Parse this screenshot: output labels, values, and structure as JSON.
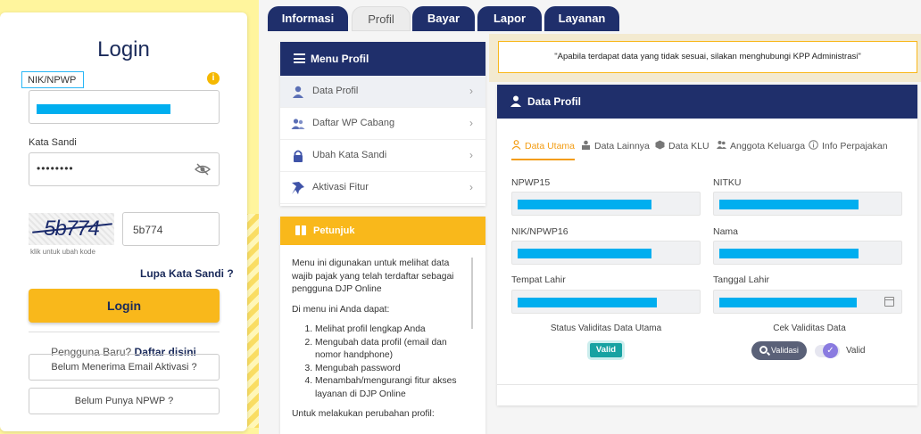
{
  "login": {
    "title": "Login",
    "nik_label": "NIK/NPWP",
    "password_label": "Kata Sandi",
    "password_value": "••••••••",
    "captcha_text": "5b774",
    "captcha_input_value": "5b774",
    "captcha_hint": "klik untuk ubah kode",
    "forgot_label": "Lupa Kata Sandi ?",
    "login_button": "Login",
    "new_user_prefix": "Pengguna Baru?",
    "new_user_link": "Daftar disini",
    "email_activation_button": "Belum Menerima Email Aktivasi ?",
    "no_npwp_button": "Belum Punya NPWP ?"
  },
  "tabs": [
    {
      "label": "Informasi",
      "active": false
    },
    {
      "label": "Profil",
      "active": true
    },
    {
      "label": "Bayar",
      "active": false
    },
    {
      "label": "Lapor",
      "active": false
    },
    {
      "label": "Layanan",
      "active": false
    }
  ],
  "menu": {
    "title": "Menu Profil",
    "items": [
      {
        "label": "Data Profil",
        "icon": "user-icon"
      },
      {
        "label": "Daftar WP Cabang",
        "icon": "users-icon"
      },
      {
        "label": "Ubah Kata Sandi",
        "icon": "lock-icon"
      },
      {
        "label": "Aktivasi Fitur",
        "icon": "pin-icon"
      }
    ]
  },
  "petunjuk": {
    "title": "Petunjuk",
    "intro": "Menu ini digunakan untuk melihat data wajib pajak yang telah terdaftar sebagai pengguna DJP Online",
    "subtitle": "Di menu ini Anda dapat:",
    "list": [
      "Melihat profil lengkap Anda",
      "Mengubah data profil (email dan nomor handphone)",
      "Mengubah password",
      "Menambah/mengurangi fitur akses layanan di DJP Online"
    ],
    "footer": "Untuk melakukan perubahan profil:"
  },
  "notice": "\"Apabila terdapat data yang tidak sesuai, silakan menghubungi KPP Administrasi\"",
  "profil": {
    "title": "Data Profil",
    "subtabs": [
      "Data Utama",
      "Data Lainnya",
      "Data KLU",
      "Anggota Keluarga",
      "Info Perpajakan"
    ],
    "fields": {
      "npwp15": "NPWP15",
      "nitku": "NITKU",
      "nik_npwp16": "NIK/NPWP16",
      "nama": "Nama",
      "tempat_lahir": "Tempat Lahir",
      "tanggal_lahir": "Tanggal Lahir"
    },
    "status_label": "Status Validitas Data Utama",
    "status_value": "Valid",
    "cek_label": "Cek Validitas Data",
    "validasi_button": "Validasi",
    "toggle_label": "Valid"
  },
  "colors": {
    "navy": "#1f2f6b",
    "accent_yellow": "#f9b81b",
    "mask_blue": "#00aeef",
    "active_orange": "#f39c12"
  }
}
